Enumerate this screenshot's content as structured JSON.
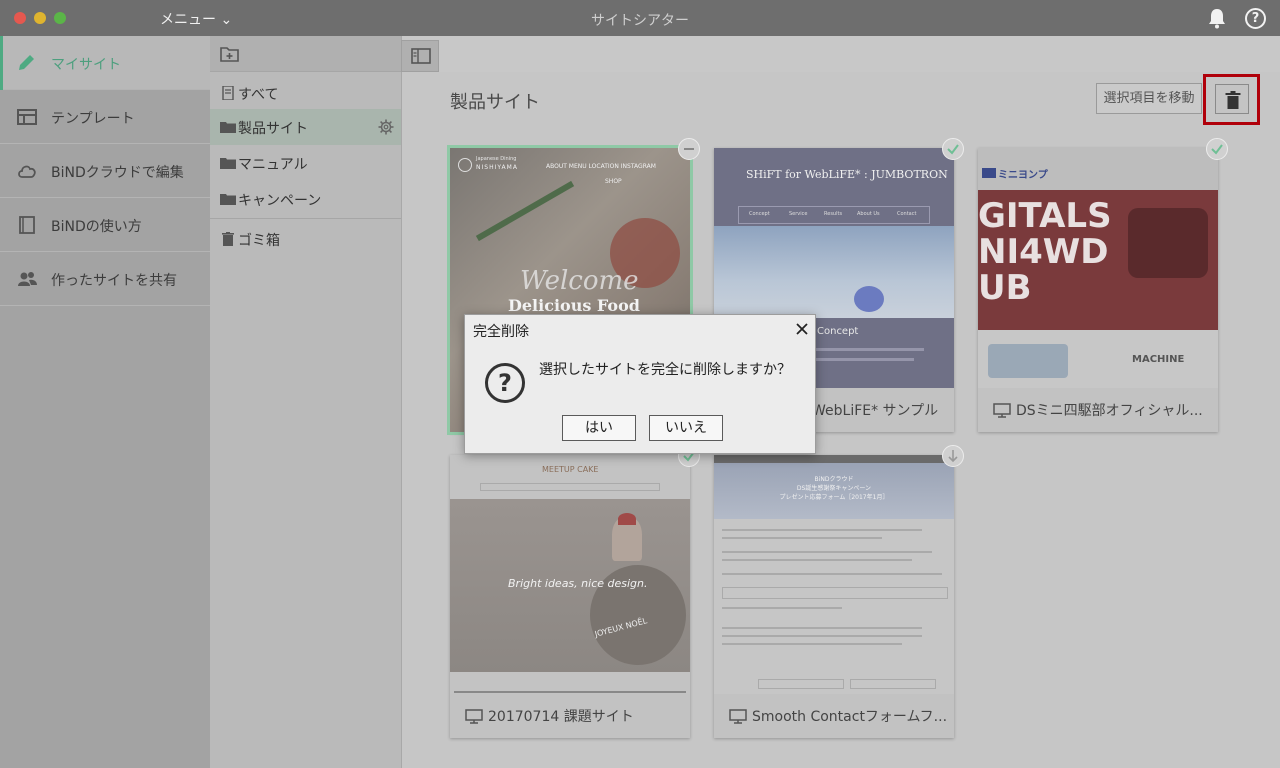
{
  "titlebar": {
    "menu_label": "メニュー ⌄",
    "app_title": "サイトシアター",
    "help_label": "?"
  },
  "sidebar": {
    "items": [
      {
        "label": "マイサイト",
        "icon": "pencil-icon"
      },
      {
        "label": "テンプレート",
        "icon": "template-icon"
      },
      {
        "label": "BiNDクラウドで編集",
        "icon": "cloud-icon"
      },
      {
        "label": "BiNDの使い方",
        "icon": "book-icon"
      },
      {
        "label": "作ったサイトを共有",
        "icon": "people-icon"
      }
    ]
  },
  "folders": {
    "items": [
      {
        "label": "すべて",
        "icon": "document-icon"
      },
      {
        "label": "製品サイト",
        "icon": "folder-icon"
      },
      {
        "label": "マニュアル",
        "icon": "folder-icon"
      },
      {
        "label": "キャンペーン",
        "icon": "folder-icon"
      },
      {
        "label": "ゴミ箱",
        "icon": "trash-icon"
      }
    ]
  },
  "main": {
    "title": "製品サイト",
    "move_button": "選択項目を移動"
  },
  "cards": [
    {
      "name": "",
      "thumb": {
        "brand_top": "Japanese Dining",
        "brand": "NISHIYAMA",
        "nav": "ABOUT   MENU   LOCATION   INSTAGRAM",
        "nav2": "SHOP",
        "welcome": "Welcome",
        "headline": "Delicious Food"
      }
    },
    {
      "name": "WebLiFE* サンプル",
      "thumb": {
        "title": "SHiFT for WebLiFE* : JUMBOTRON",
        "nav": [
          "Concept",
          "Service",
          "Results",
          "About Us",
          "Contact"
        ],
        "section": "Concept"
      }
    },
    {
      "name": "DSミニ四駆部オフィシャル...",
      "thumb": {
        "logo": "ミニヨンプ",
        "banner": "GITALS\nNI4WD\nUB",
        "section": "MACHINE"
      }
    },
    {
      "name": "20170714 課題サイト",
      "thumb": {
        "logo": "MEETUP CAKE",
        "tagline": "Bright ideas, nice design.",
        "card_text": "JOYEUX NOËL"
      }
    },
    {
      "name": "Smooth Contactフォームフ...",
      "thumb": {
        "header": "BiNDクラウド\nDS誕生感謝祭キャンペーン\nプレゼント応募フォーム［2017年1月］"
      }
    }
  ],
  "dialog": {
    "title": "完全削除",
    "message": "選択したサイトを完全に削除しますか？",
    "yes": "はい",
    "no": "いいえ",
    "icon": "question-icon"
  },
  "colors": {
    "accent": "#4eaa82",
    "highlight": "#b0000a"
  }
}
